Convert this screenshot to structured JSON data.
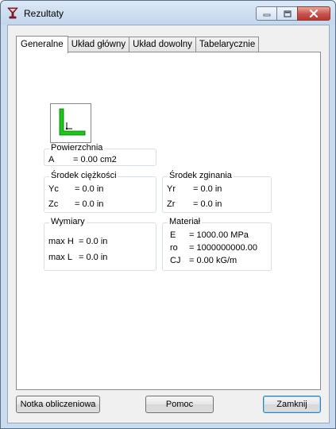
{
  "window": {
    "title": "Rezultaty"
  },
  "tabs": [
    {
      "label": "Generalne",
      "active": true
    },
    {
      "label": "Układ główny",
      "active": false
    },
    {
      "label": "Układ dowolny",
      "active": false
    },
    {
      "label": "Tabelarycznie",
      "active": false
    }
  ],
  "groups": {
    "area": {
      "title": "Powierzchnia",
      "rows": [
        {
          "key": "A",
          "value": "= 0.00 cm2"
        }
      ]
    },
    "centroid": {
      "title": "Środek ciężkości",
      "rows": [
        {
          "key": "Yc",
          "value": "= 0.0 in"
        },
        {
          "key": "Zc",
          "value": "= 0.0 in"
        }
      ]
    },
    "shear_center": {
      "title": "Środek zginania",
      "rows": [
        {
          "key": "Yr",
          "value": "= 0.0 in"
        },
        {
          "key": "Zr",
          "value": "= 0.0 in"
        }
      ]
    },
    "dimensions": {
      "title": "Wymiary",
      "rows": [
        {
          "key": "max H",
          "value": "= 0.0 in"
        },
        {
          "key": "max L",
          "value": "= 0.0 in"
        }
      ]
    },
    "material": {
      "title": "Materiał",
      "rows": [
        {
          "key": "E",
          "value": "= 1000.00 MPa"
        },
        {
          "key": "ro",
          "value": "= 1000000000.00"
        },
        {
          "key": "CJ",
          "value": "= 0.00 kG/m"
        }
      ]
    }
  },
  "buttons": {
    "report": "Notka obliczeniowa",
    "help": "Pomoc",
    "close": "Zamknij"
  },
  "icons": {
    "app": "wine-glass-icon",
    "section_preview": "l-section-icon",
    "minimize": "minimize-icon",
    "maximize": "maximize-icon",
    "close": "close-icon"
  },
  "colors": {
    "section_fill": "#19c819",
    "close_button": "#c75050",
    "app_icon": "#9b1b30"
  }
}
